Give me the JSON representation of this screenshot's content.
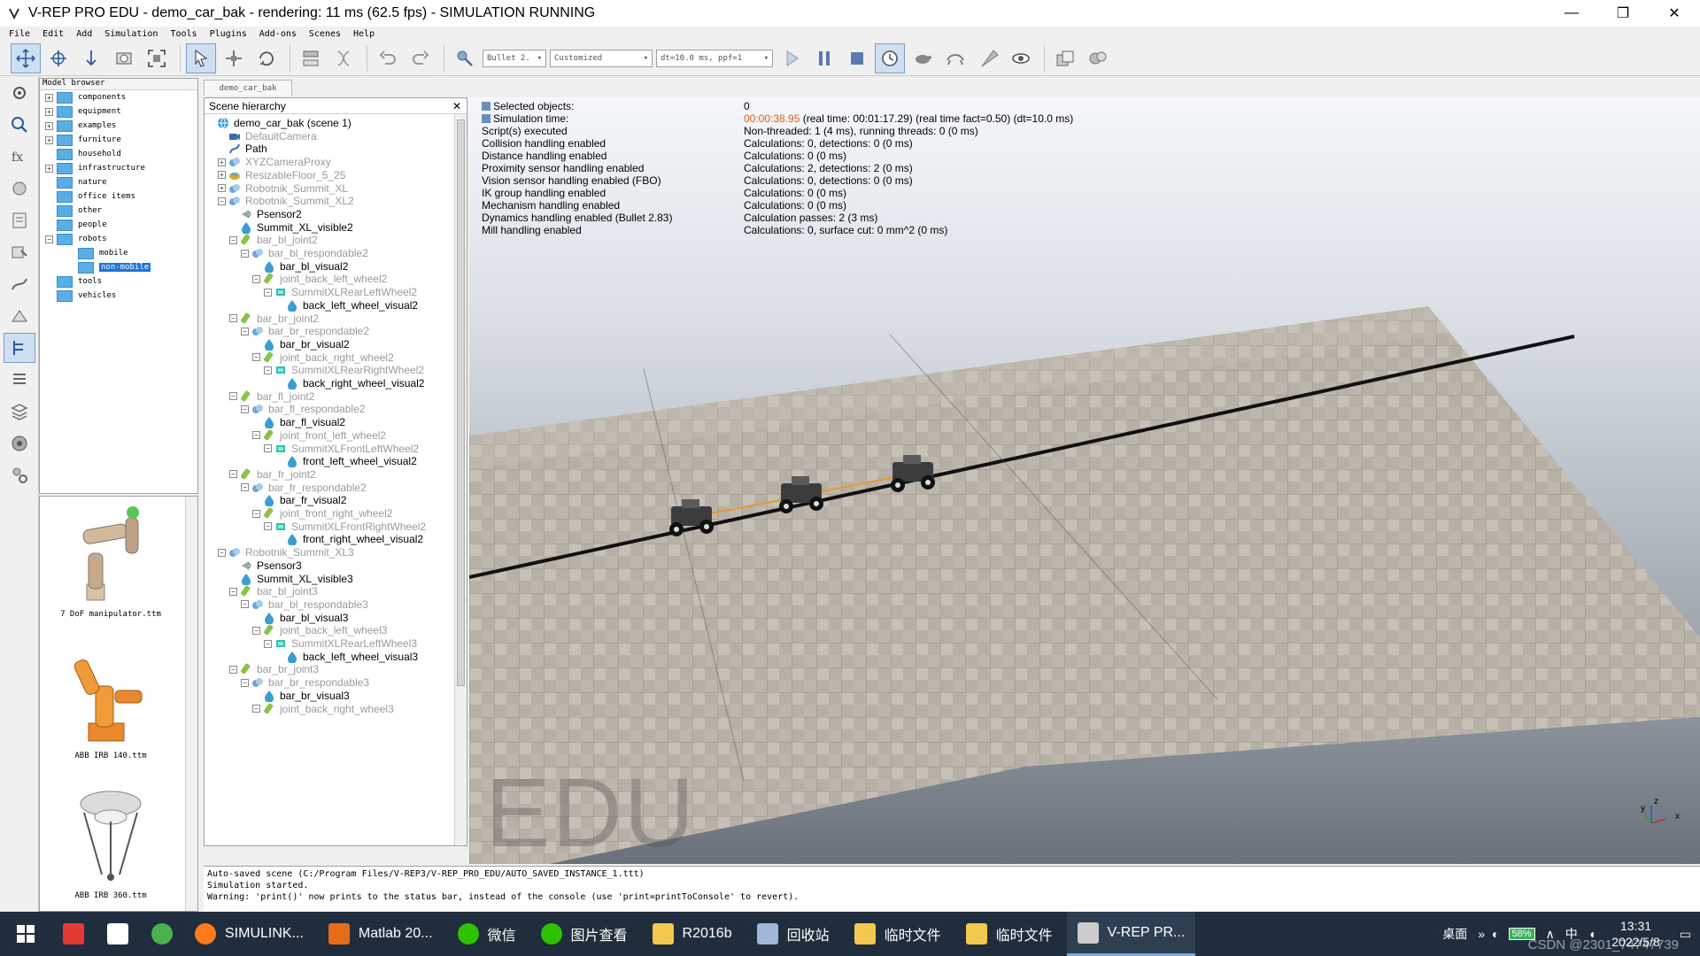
{
  "window": {
    "title": "V-REP PRO EDU - demo_car_bak - rendering: 11 ms (62.5 fps) - SIMULATION RUNNING",
    "minimize": "—",
    "restore": "❐",
    "close": "✕"
  },
  "menu": [
    "File",
    "Edit",
    "Add",
    "Simulation",
    "Tools",
    "Plugins",
    "Add-ons",
    "Scenes",
    "Help"
  ],
  "toolbar": {
    "engine_select": "Bullet 2.",
    "accuracy_select": "Customized",
    "timestep_select": "dt=10.0 ms, ppf=1"
  },
  "model_browser": {
    "header": "Model browser",
    "items": [
      {
        "label": "components",
        "exp": "+"
      },
      {
        "label": "equipment",
        "exp": "+"
      },
      {
        "label": "examples",
        "exp": "+"
      },
      {
        "label": "furniture",
        "exp": "+"
      },
      {
        "label": "household",
        "exp": ""
      },
      {
        "label": "infrastructure",
        "exp": "+"
      },
      {
        "label": "nature",
        "exp": ""
      },
      {
        "label": "office items",
        "exp": ""
      },
      {
        "label": "other",
        "exp": ""
      },
      {
        "label": "people",
        "exp": ""
      },
      {
        "label": "robots",
        "exp": "−"
      },
      {
        "label": "mobile",
        "exp": "",
        "indent": true
      },
      {
        "label": "non-mobile",
        "exp": "",
        "indent": true,
        "selected": true
      },
      {
        "label": "tools",
        "exp": ""
      },
      {
        "label": "vehicles",
        "exp": ""
      }
    ],
    "thumbnails": [
      "7 DoF manipulator.ttm",
      "ABB IRB 140.ttm",
      "ABB IRB 360.ttm"
    ]
  },
  "scene_tab": "demo_car_bak",
  "hierarchy": {
    "header": "Scene hierarchy",
    "close": "✕",
    "rows": [
      {
        "label": "demo_car_bak (scene 1)",
        "level": 0,
        "color": "black",
        "icon": "scene",
        "exp": ""
      },
      {
        "label": "DefaultCamera",
        "level": 1,
        "color": "gray",
        "icon": "camera",
        "exp": ""
      },
      {
        "label": "Path",
        "level": 1,
        "color": "black",
        "icon": "path",
        "exp": ""
      },
      {
        "label": "XYZCameraProxy",
        "level": 1,
        "color": "gray",
        "icon": "shape",
        "exp": "+"
      },
      {
        "label": "ResizableFloor_5_25",
        "level": 1,
        "color": "gray",
        "icon": "floor",
        "exp": "+"
      },
      {
        "label": "Robotnik_Summit_XL",
        "level": 1,
        "color": "gray",
        "icon": "shape",
        "exp": "+"
      },
      {
        "label": "Robotnik_Summit_XL2",
        "level": 1,
        "color": "gray",
        "icon": "shape",
        "exp": "−"
      },
      {
        "label": "Psensor2",
        "level": 2,
        "color": "black",
        "icon": "sensor",
        "exp": ""
      },
      {
        "label": "Summit_XL_visible2",
        "level": 2,
        "color": "black",
        "icon": "visual",
        "exp": ""
      },
      {
        "label": "bar_bl_joint2",
        "level": 2,
        "color": "gray",
        "icon": "joint",
        "exp": "−"
      },
      {
        "label": "bar_bl_respondable2",
        "level": 3,
        "color": "gray",
        "icon": "shape",
        "exp": "−"
      },
      {
        "label": "bar_bl_visual2",
        "level": 4,
        "color": "black",
        "icon": "visual",
        "exp": ""
      },
      {
        "label": "joint_back_left_wheel2",
        "level": 4,
        "color": "gray",
        "icon": "joint",
        "exp": "−"
      },
      {
        "label": "SummitXLRearLeftWheel2",
        "level": 5,
        "color": "gray",
        "icon": "wheel",
        "exp": "−"
      },
      {
        "label": "back_left_wheel_visual2",
        "level": 6,
        "color": "black",
        "icon": "visual",
        "exp": ""
      },
      {
        "label": "bar_br_joint2",
        "level": 2,
        "color": "gray",
        "icon": "joint",
        "exp": "−"
      },
      {
        "label": "bar_br_respondable2",
        "level": 3,
        "color": "gray",
        "icon": "shape",
        "exp": "−"
      },
      {
        "label": "bar_br_visual2",
        "level": 4,
        "color": "black",
        "icon": "visual",
        "exp": ""
      },
      {
        "label": "joint_back_right_wheel2",
        "level": 4,
        "color": "gray",
        "icon": "joint",
        "exp": "−"
      },
      {
        "label": "SummitXLRearRightWheel2",
        "level": 5,
        "color": "gray",
        "icon": "wheel",
        "exp": "−"
      },
      {
        "label": "back_right_wheel_visual2",
        "level": 6,
        "color": "black",
        "icon": "visual",
        "exp": ""
      },
      {
        "label": "bar_fl_joint2",
        "level": 2,
        "color": "gray",
        "icon": "joint",
        "exp": "−"
      },
      {
        "label": "bar_fl_respondable2",
        "level": 3,
        "color": "gray",
        "icon": "shape",
        "exp": "−"
      },
      {
        "label": "bar_fl_visual2",
        "level": 4,
        "color": "black",
        "icon": "visual",
        "exp": ""
      },
      {
        "label": "joint_front_left_wheel2",
        "level": 4,
        "color": "gray",
        "icon": "joint",
        "exp": "−"
      },
      {
        "label": "SummitXLFrontLeftWheel2",
        "level": 5,
        "color": "gray",
        "icon": "wheel",
        "exp": "−"
      },
      {
        "label": "front_left_wheel_visual2",
        "level": 6,
        "color": "black",
        "icon": "visual",
        "exp": ""
      },
      {
        "label": "bar_fr_joint2",
        "level": 2,
        "color": "gray",
        "icon": "joint",
        "exp": "−"
      },
      {
        "label": "bar_fr_respondable2",
        "level": 3,
        "color": "gray",
        "icon": "shape",
        "exp": "−"
      },
      {
        "label": "bar_fr_visual2",
        "level": 4,
        "color": "black",
        "icon": "visual",
        "exp": ""
      },
      {
        "label": "joint_front_right_wheel2",
        "level": 4,
        "color": "gray",
        "icon": "joint",
        "exp": "−"
      },
      {
        "label": "SummitXLFrontRightWheel2",
        "level": 5,
        "color": "gray",
        "icon": "wheel",
        "exp": "−"
      },
      {
        "label": "front_right_wheel_visual2",
        "level": 6,
        "color": "black",
        "icon": "visual",
        "exp": ""
      },
      {
        "label": "Robotnik_Summit_XL3",
        "level": 1,
        "color": "gray",
        "icon": "shape",
        "exp": "−"
      },
      {
        "label": "Psensor3",
        "level": 2,
        "color": "black",
        "icon": "sensor",
        "exp": ""
      },
      {
        "label": "Summit_XL_visible3",
        "level": 2,
        "color": "black",
        "icon": "visual",
        "exp": ""
      },
      {
        "label": "bar_bl_joint3",
        "level": 2,
        "color": "gray",
        "icon": "joint",
        "exp": "−"
      },
      {
        "label": "bar_bl_respondable3",
        "level": 3,
        "color": "gray",
        "icon": "shape",
        "exp": "−"
      },
      {
        "label": "bar_bl_visual3",
        "level": 4,
        "color": "black",
        "icon": "visual",
        "exp": ""
      },
      {
        "label": "joint_back_left_wheel3",
        "level": 4,
        "color": "gray",
        "icon": "joint",
        "exp": "−"
      },
      {
        "label": "SummitXLRearLeftWheel3",
        "level": 5,
        "color": "gray",
        "icon": "wheel",
        "exp": "−"
      },
      {
        "label": "back_left_wheel_visual3",
        "level": 6,
        "color": "black",
        "icon": "visual",
        "exp": ""
      },
      {
        "label": "bar_br_joint3",
        "level": 2,
        "color": "gray",
        "icon": "joint",
        "exp": "−"
      },
      {
        "label": "bar_br_respondable3",
        "level": 3,
        "color": "gray",
        "icon": "shape",
        "exp": "−"
      },
      {
        "label": "bar_br_visual3",
        "level": 4,
        "color": "black",
        "icon": "visual",
        "exp": ""
      },
      {
        "label": "joint_back_right_wheel3",
        "level": 4,
        "color": "gray",
        "icon": "joint",
        "exp": "−"
      }
    ]
  },
  "info": {
    "left": [
      "Selected objects:",
      "Simulation time:",
      "Script(s) executed",
      "Collision handling enabled",
      "Distance handling enabled",
      "Proximity sensor handling enabled",
      "Vision sensor handling enabled (FBO)",
      "IK group handling enabled",
      "Mechanism handling enabled",
      "Dynamics handling enabled (Bullet 2.83)",
      "Mill handling enabled"
    ],
    "sim_time": "00:00:38.95",
    "sim_time_rest": " (real time: 00:01:17.29) (real time fact=0.50) (dt=10.0 ms)",
    "right": [
      "0",
      "",
      "Non-threaded: 1 (4 ms), running threads: 0 (0 ms)",
      "Calculations: 0, detections: 0 (0 ms)",
      "Calculations: 0 (0 ms)",
      "Calculations: 2, detections: 2 (0 ms)",
      "Calculations: 0, detections: 0 (0 ms)",
      "Calculations: 0 (0 ms)",
      "Calculations: 0 (0 ms)",
      "Calculation passes: 2 (3 ms)",
      "Calculations: 0, surface cut: 0 mm^2 (0 ms)"
    ]
  },
  "viewport": {
    "watermark": "EDU",
    "axis_z": "z",
    "axis_y": "y",
    "axis_x": "x"
  },
  "console": [
    "Auto-saved scene (C:/Program Files/V-REP3/V-REP_PRO_EDU/AUTO_SAVED_INSTANCE_1.ttt)",
    "Simulation started.",
    "Warning: 'print()' now prints to the status bar, instead of the console (use 'print=printToConsole' to revert)."
  ],
  "taskbar": {
    "apps": [
      {
        "label": "",
        "icon": "youdao-icon"
      },
      {
        "label": "",
        "icon": "typora-icon"
      },
      {
        "label": "",
        "icon": "chrome-icon"
      },
      {
        "label": "SIMULINK...",
        "icon": "firefox-icon"
      },
      {
        "label": "Matlab 20...",
        "icon": "matlab-icon"
      },
      {
        "label": "微信",
        "icon": "wechat-icon"
      },
      {
        "label": "图片查看",
        "icon": "wechat-icon"
      },
      {
        "label": "R2016b",
        "icon": "folder-icon"
      },
      {
        "label": "回收站",
        "icon": "recycle-icon"
      },
      {
        "label": "临时文件",
        "icon": "folder-icon"
      },
      {
        "label": "临时文件",
        "icon": "folder-icon"
      },
      {
        "label": "V-REP PR...",
        "icon": "vrep-icon"
      }
    ],
    "desktop": "桌面",
    "battery": "58%",
    "ime": "中",
    "time": "13:31",
    "date": "2022/5/8",
    "watermark": "CSDN @2301_74747739"
  },
  "colors": {
    "accent": "#1e73d8",
    "sim_time": "#e06010",
    "taskbar": "#1f2d3d"
  }
}
